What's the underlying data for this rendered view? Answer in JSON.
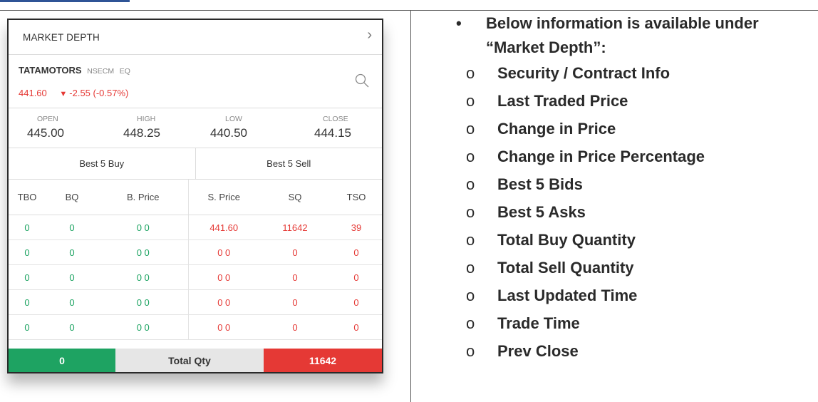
{
  "widget": {
    "title": "MARKET DEPTH",
    "security": {
      "symbol": "TATAMOTORS",
      "segment": "NSECM",
      "series": "EQ",
      "ltp": "441.60",
      "change": "-2.55 (-0.57%)"
    },
    "ohlc": [
      {
        "label": "OPEN",
        "value": "445.00"
      },
      {
        "label": "HIGH",
        "value": "448.25"
      },
      {
        "label": "LOW",
        "value": "440.50"
      },
      {
        "label": "CLOSE",
        "value": "444.15"
      }
    ],
    "best_buy_label": "Best 5 Buy",
    "best_sell_label": "Best 5 Sell",
    "columns": [
      "TBO",
      "BQ",
      "B. Price",
      "S. Price",
      "SQ",
      "TSO"
    ],
    "rows": [
      [
        "0",
        "0",
        "0 0",
        "441.60",
        "11642",
        "39"
      ],
      [
        "0",
        "0",
        "0 0",
        "0 0",
        "0",
        "0"
      ],
      [
        "0",
        "0",
        "0 0",
        "0 0",
        "0",
        "0"
      ],
      [
        "0",
        "0",
        "0 0",
        "0 0",
        "0",
        "0"
      ],
      [
        "0",
        "0",
        "0 0",
        "0 0",
        "0",
        "0"
      ]
    ],
    "total_buy": "0",
    "total_label": "Total Qty",
    "total_sell": "11642",
    "colors": {
      "buy": "#1ea362",
      "sell": "#e53935",
      "neutral": "#e6e6e6"
    }
  },
  "info": {
    "intro": "Below information is available under “Market Depth”:",
    "items": [
      "Security / Contract Info",
      "Last Traded Price",
      "Change in Price",
      "Change in Price Percentage",
      "Best 5 Bids",
      "Best 5 Asks",
      "Total Buy Quantity",
      "Total Sell Quantity",
      "Last Updated Time",
      "Trade Time",
      "Prev Close"
    ]
  }
}
